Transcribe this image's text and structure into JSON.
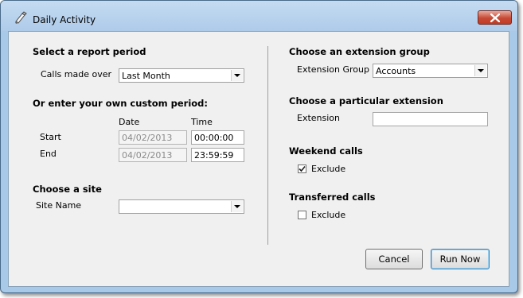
{
  "window": {
    "title": "Daily Activity"
  },
  "left": {
    "report_period": {
      "heading": "Select a report period",
      "calls_label": "Calls made over",
      "calls_value": "Last Month"
    },
    "custom_period": {
      "heading": "Or enter your own custom period:",
      "date_col": "Date",
      "time_col": "Time",
      "start_label": "Start",
      "start_date": "04/02/2013",
      "start_time": "00:00:00",
      "end_label": "End",
      "end_date": "04/02/2013",
      "end_time": "23:59:59"
    },
    "site": {
      "heading": "Choose a site",
      "label": "Site Name",
      "value": ""
    }
  },
  "right": {
    "extension_group": {
      "heading": "Choose an extension group",
      "label": "Extension Group",
      "value": "Accounts"
    },
    "extension": {
      "heading": "Choose a particular extension",
      "label": "Extension",
      "value": ""
    },
    "weekend": {
      "heading": "Weekend calls",
      "exclude_label": "Exclude",
      "checked": true
    },
    "transferred": {
      "heading": "Transferred calls",
      "exclude_label": "Exclude",
      "checked": false
    }
  },
  "buttons": {
    "cancel": "Cancel",
    "run": "Run Now"
  }
}
